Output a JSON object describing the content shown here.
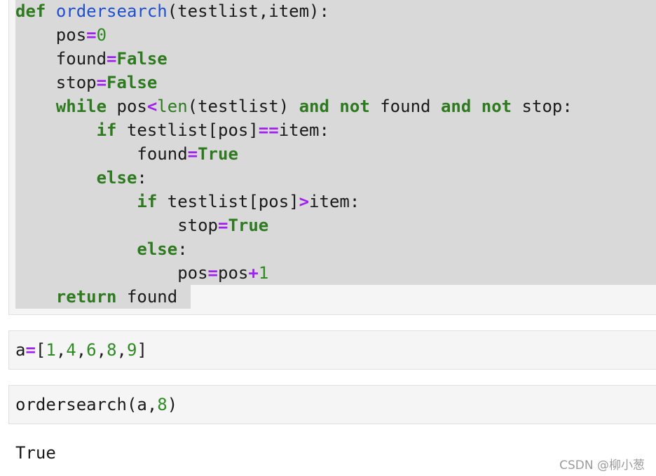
{
  "cells": [
    {
      "lines": [
        [
          {
            "t": "kw",
            "v": "def"
          },
          {
            "t": "",
            "v": " "
          },
          {
            "t": "fn",
            "v": "ordersearch"
          },
          {
            "t": "",
            "v": "(testlist,item):"
          }
        ],
        [
          {
            "t": "",
            "v": "    pos"
          },
          {
            "t": "op",
            "v": "="
          },
          {
            "t": "num",
            "v": "0"
          }
        ],
        [
          {
            "t": "",
            "v": "    found"
          },
          {
            "t": "op",
            "v": "="
          },
          {
            "t": "kw",
            "v": "False"
          }
        ],
        [
          {
            "t": "",
            "v": "    stop"
          },
          {
            "t": "op",
            "v": "="
          },
          {
            "t": "kw",
            "v": "False"
          }
        ],
        [
          {
            "t": "",
            "v": "    "
          },
          {
            "t": "kw",
            "v": "while"
          },
          {
            "t": "",
            "v": " pos"
          },
          {
            "t": "op",
            "v": "<"
          },
          {
            "t": "bi",
            "v": "len"
          },
          {
            "t": "",
            "v": "(testlist) "
          },
          {
            "t": "kw",
            "v": "and"
          },
          {
            "t": "",
            "v": " "
          },
          {
            "t": "kw",
            "v": "not"
          },
          {
            "t": "",
            "v": " found "
          },
          {
            "t": "kw",
            "v": "and"
          },
          {
            "t": "",
            "v": " "
          },
          {
            "t": "kw",
            "v": "not"
          },
          {
            "t": "",
            "v": " stop:"
          }
        ],
        [
          {
            "t": "",
            "v": "        "
          },
          {
            "t": "kw",
            "v": "if"
          },
          {
            "t": "",
            "v": " testlist[pos]"
          },
          {
            "t": "op",
            "v": "=="
          },
          {
            "t": "",
            "v": "item:"
          }
        ],
        [
          {
            "t": "",
            "v": "            found"
          },
          {
            "t": "op",
            "v": "="
          },
          {
            "t": "kw",
            "v": "True"
          }
        ],
        [
          {
            "t": "",
            "v": "        "
          },
          {
            "t": "kw",
            "v": "else"
          },
          {
            "t": "",
            "v": ":"
          }
        ],
        [
          {
            "t": "",
            "v": "            "
          },
          {
            "t": "kw",
            "v": "if"
          },
          {
            "t": "",
            "v": " testlist[pos]"
          },
          {
            "t": "op",
            "v": ">"
          },
          {
            "t": "",
            "v": "item:"
          }
        ],
        [
          {
            "t": "",
            "v": "                stop"
          },
          {
            "t": "op",
            "v": "="
          },
          {
            "t": "kw",
            "v": "True"
          }
        ],
        [
          {
            "t": "",
            "v": "            "
          },
          {
            "t": "kw",
            "v": "else"
          },
          {
            "t": "",
            "v": ":"
          }
        ],
        [
          {
            "t": "",
            "v": "                pos"
          },
          {
            "t": "op",
            "v": "="
          },
          {
            "t": "",
            "v": "pos"
          },
          {
            "t": "op",
            "v": "+"
          },
          {
            "t": "num",
            "v": "1"
          }
        ],
        [
          {
            "t": "",
            "v": "    "
          },
          {
            "t": "kw",
            "v": "return"
          },
          {
            "t": "",
            "v": " found"
          }
        ]
      ]
    },
    {
      "lines": [
        [
          {
            "t": "",
            "v": "a"
          },
          {
            "t": "op",
            "v": "="
          },
          {
            "t": "",
            "v": "["
          },
          {
            "t": "num",
            "v": "1"
          },
          {
            "t": "",
            "v": ","
          },
          {
            "t": "num",
            "v": "4"
          },
          {
            "t": "",
            "v": ","
          },
          {
            "t": "num",
            "v": "6"
          },
          {
            "t": "",
            "v": ","
          },
          {
            "t": "num",
            "v": "8"
          },
          {
            "t": "",
            "v": ","
          },
          {
            "t": "num",
            "v": "9"
          },
          {
            "t": "",
            "v": "]"
          }
        ]
      ]
    },
    {
      "lines": [
        [
          {
            "t": "",
            "v": "ordersearch(a,"
          },
          {
            "t": "num",
            "v": "8"
          },
          {
            "t": "",
            "v": ")"
          }
        ]
      ]
    }
  ],
  "output": "True",
  "watermark": "CSDN @柳小葱",
  "colors": {
    "keyword": "#2e7a1f",
    "function": "#1f4fd1",
    "operator": "#a020f0",
    "number": "#2e8b22",
    "selection": "#d9d9d9",
    "cell_bg": "#f5f5f5"
  }
}
